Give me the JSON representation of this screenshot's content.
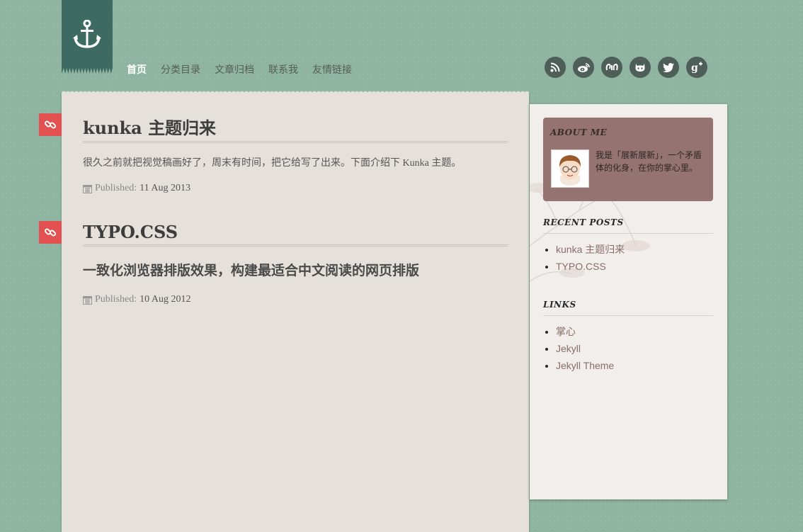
{
  "nav": {
    "items": [
      "首页",
      "分类目录",
      "文章归档",
      "联系我",
      "友情链接"
    ]
  },
  "social": {
    "icons": [
      "rss-icon",
      "weibo-icon",
      "douban-icon",
      "github-icon",
      "twitter-icon",
      "google-plus-icon"
    ]
  },
  "posts": [
    {
      "title": "kunka 主题归来",
      "excerpt": "很久之前就把视觉稿画好了，周末有时间，把它给写了出来。下面介绍下 Kunka 主题。",
      "published_label": "Published:",
      "date": "11 Aug 2013"
    },
    {
      "title": "TYPO.CSS",
      "excerpt": "一致化浏览器排版效果，构建最适合中文阅读的网页排版",
      "published_label": "Published:",
      "date": "10 Aug 2012"
    }
  ],
  "sidebar": {
    "about": {
      "title": "ABOUT ME",
      "text": "我是「展新展新」，一个矛盾体的化身，在你的掌心里。"
    },
    "recent": {
      "title": "RECENT POSTS",
      "items": [
        "kunka 主题归来",
        "TYPO.CSS"
      ]
    },
    "links": {
      "title": "LINKS",
      "items": [
        "掌心",
        "Jekyll",
        "Jekyll Theme"
      ]
    }
  },
  "colors": {
    "background": "#8fb5a2",
    "accent_red": "#e2504f",
    "about_bg": "#947370",
    "logo_bg": "#3e6b61"
  }
}
